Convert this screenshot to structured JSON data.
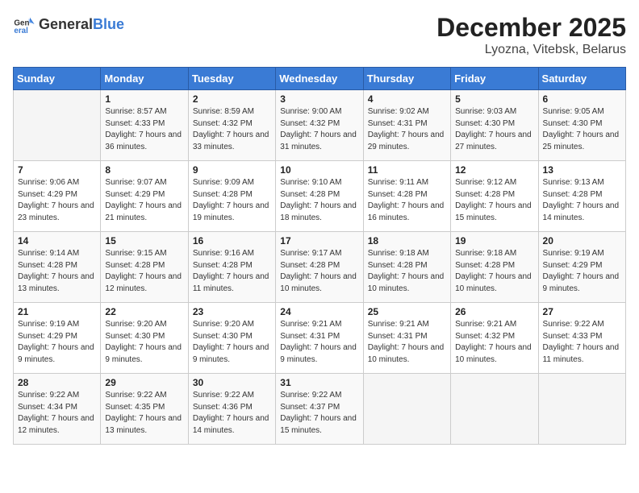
{
  "header": {
    "logo_general": "General",
    "logo_blue": "Blue",
    "month_title": "December 2025",
    "location": "Lyozna, Vitebsk, Belarus"
  },
  "days_of_week": [
    "Sunday",
    "Monday",
    "Tuesday",
    "Wednesday",
    "Thursday",
    "Friday",
    "Saturday"
  ],
  "weeks": [
    [
      {
        "day": "",
        "sunrise": "",
        "sunset": "",
        "daylight": ""
      },
      {
        "day": "1",
        "sunrise": "Sunrise: 8:57 AM",
        "sunset": "Sunset: 4:33 PM",
        "daylight": "Daylight: 7 hours and 36 minutes."
      },
      {
        "day": "2",
        "sunrise": "Sunrise: 8:59 AM",
        "sunset": "Sunset: 4:32 PM",
        "daylight": "Daylight: 7 hours and 33 minutes."
      },
      {
        "day": "3",
        "sunrise": "Sunrise: 9:00 AM",
        "sunset": "Sunset: 4:32 PM",
        "daylight": "Daylight: 7 hours and 31 minutes."
      },
      {
        "day": "4",
        "sunrise": "Sunrise: 9:02 AM",
        "sunset": "Sunset: 4:31 PM",
        "daylight": "Daylight: 7 hours and 29 minutes."
      },
      {
        "day": "5",
        "sunrise": "Sunrise: 9:03 AM",
        "sunset": "Sunset: 4:30 PM",
        "daylight": "Daylight: 7 hours and 27 minutes."
      },
      {
        "day": "6",
        "sunrise": "Sunrise: 9:05 AM",
        "sunset": "Sunset: 4:30 PM",
        "daylight": "Daylight: 7 hours and 25 minutes."
      }
    ],
    [
      {
        "day": "7",
        "sunrise": "Sunrise: 9:06 AM",
        "sunset": "Sunset: 4:29 PM",
        "daylight": "Daylight: 7 hours and 23 minutes."
      },
      {
        "day": "8",
        "sunrise": "Sunrise: 9:07 AM",
        "sunset": "Sunset: 4:29 PM",
        "daylight": "Daylight: 7 hours and 21 minutes."
      },
      {
        "day": "9",
        "sunrise": "Sunrise: 9:09 AM",
        "sunset": "Sunset: 4:28 PM",
        "daylight": "Daylight: 7 hours and 19 minutes."
      },
      {
        "day": "10",
        "sunrise": "Sunrise: 9:10 AM",
        "sunset": "Sunset: 4:28 PM",
        "daylight": "Daylight: 7 hours and 18 minutes."
      },
      {
        "day": "11",
        "sunrise": "Sunrise: 9:11 AM",
        "sunset": "Sunset: 4:28 PM",
        "daylight": "Daylight: 7 hours and 16 minutes."
      },
      {
        "day": "12",
        "sunrise": "Sunrise: 9:12 AM",
        "sunset": "Sunset: 4:28 PM",
        "daylight": "Daylight: 7 hours and 15 minutes."
      },
      {
        "day": "13",
        "sunrise": "Sunrise: 9:13 AM",
        "sunset": "Sunset: 4:28 PM",
        "daylight": "Daylight: 7 hours and 14 minutes."
      }
    ],
    [
      {
        "day": "14",
        "sunrise": "Sunrise: 9:14 AM",
        "sunset": "Sunset: 4:28 PM",
        "daylight": "Daylight: 7 hours and 13 minutes."
      },
      {
        "day": "15",
        "sunrise": "Sunrise: 9:15 AM",
        "sunset": "Sunset: 4:28 PM",
        "daylight": "Daylight: 7 hours and 12 minutes."
      },
      {
        "day": "16",
        "sunrise": "Sunrise: 9:16 AM",
        "sunset": "Sunset: 4:28 PM",
        "daylight": "Daylight: 7 hours and 11 minutes."
      },
      {
        "day": "17",
        "sunrise": "Sunrise: 9:17 AM",
        "sunset": "Sunset: 4:28 PM",
        "daylight": "Daylight: 7 hours and 10 minutes."
      },
      {
        "day": "18",
        "sunrise": "Sunrise: 9:18 AM",
        "sunset": "Sunset: 4:28 PM",
        "daylight": "Daylight: 7 hours and 10 minutes."
      },
      {
        "day": "19",
        "sunrise": "Sunrise: 9:18 AM",
        "sunset": "Sunset: 4:28 PM",
        "daylight": "Daylight: 7 hours and 10 minutes."
      },
      {
        "day": "20",
        "sunrise": "Sunrise: 9:19 AM",
        "sunset": "Sunset: 4:29 PM",
        "daylight": "Daylight: 7 hours and 9 minutes."
      }
    ],
    [
      {
        "day": "21",
        "sunrise": "Sunrise: 9:19 AM",
        "sunset": "Sunset: 4:29 PM",
        "daylight": "Daylight: 7 hours and 9 minutes."
      },
      {
        "day": "22",
        "sunrise": "Sunrise: 9:20 AM",
        "sunset": "Sunset: 4:30 PM",
        "daylight": "Daylight: 7 hours and 9 minutes."
      },
      {
        "day": "23",
        "sunrise": "Sunrise: 9:20 AM",
        "sunset": "Sunset: 4:30 PM",
        "daylight": "Daylight: 7 hours and 9 minutes."
      },
      {
        "day": "24",
        "sunrise": "Sunrise: 9:21 AM",
        "sunset": "Sunset: 4:31 PM",
        "daylight": "Daylight: 7 hours and 9 minutes."
      },
      {
        "day": "25",
        "sunrise": "Sunrise: 9:21 AM",
        "sunset": "Sunset: 4:31 PM",
        "daylight": "Daylight: 7 hours and 10 minutes."
      },
      {
        "day": "26",
        "sunrise": "Sunrise: 9:21 AM",
        "sunset": "Sunset: 4:32 PM",
        "daylight": "Daylight: 7 hours and 10 minutes."
      },
      {
        "day": "27",
        "sunrise": "Sunrise: 9:22 AM",
        "sunset": "Sunset: 4:33 PM",
        "daylight": "Daylight: 7 hours and 11 minutes."
      }
    ],
    [
      {
        "day": "28",
        "sunrise": "Sunrise: 9:22 AM",
        "sunset": "Sunset: 4:34 PM",
        "daylight": "Daylight: 7 hours and 12 minutes."
      },
      {
        "day": "29",
        "sunrise": "Sunrise: 9:22 AM",
        "sunset": "Sunset: 4:35 PM",
        "daylight": "Daylight: 7 hours and 13 minutes."
      },
      {
        "day": "30",
        "sunrise": "Sunrise: 9:22 AM",
        "sunset": "Sunset: 4:36 PM",
        "daylight": "Daylight: 7 hours and 14 minutes."
      },
      {
        "day": "31",
        "sunrise": "Sunrise: 9:22 AM",
        "sunset": "Sunset: 4:37 PM",
        "daylight": "Daylight: 7 hours and 15 minutes."
      },
      {
        "day": "",
        "sunrise": "",
        "sunset": "",
        "daylight": ""
      },
      {
        "day": "",
        "sunrise": "",
        "sunset": "",
        "daylight": ""
      },
      {
        "day": "",
        "sunrise": "",
        "sunset": "",
        "daylight": ""
      }
    ]
  ]
}
